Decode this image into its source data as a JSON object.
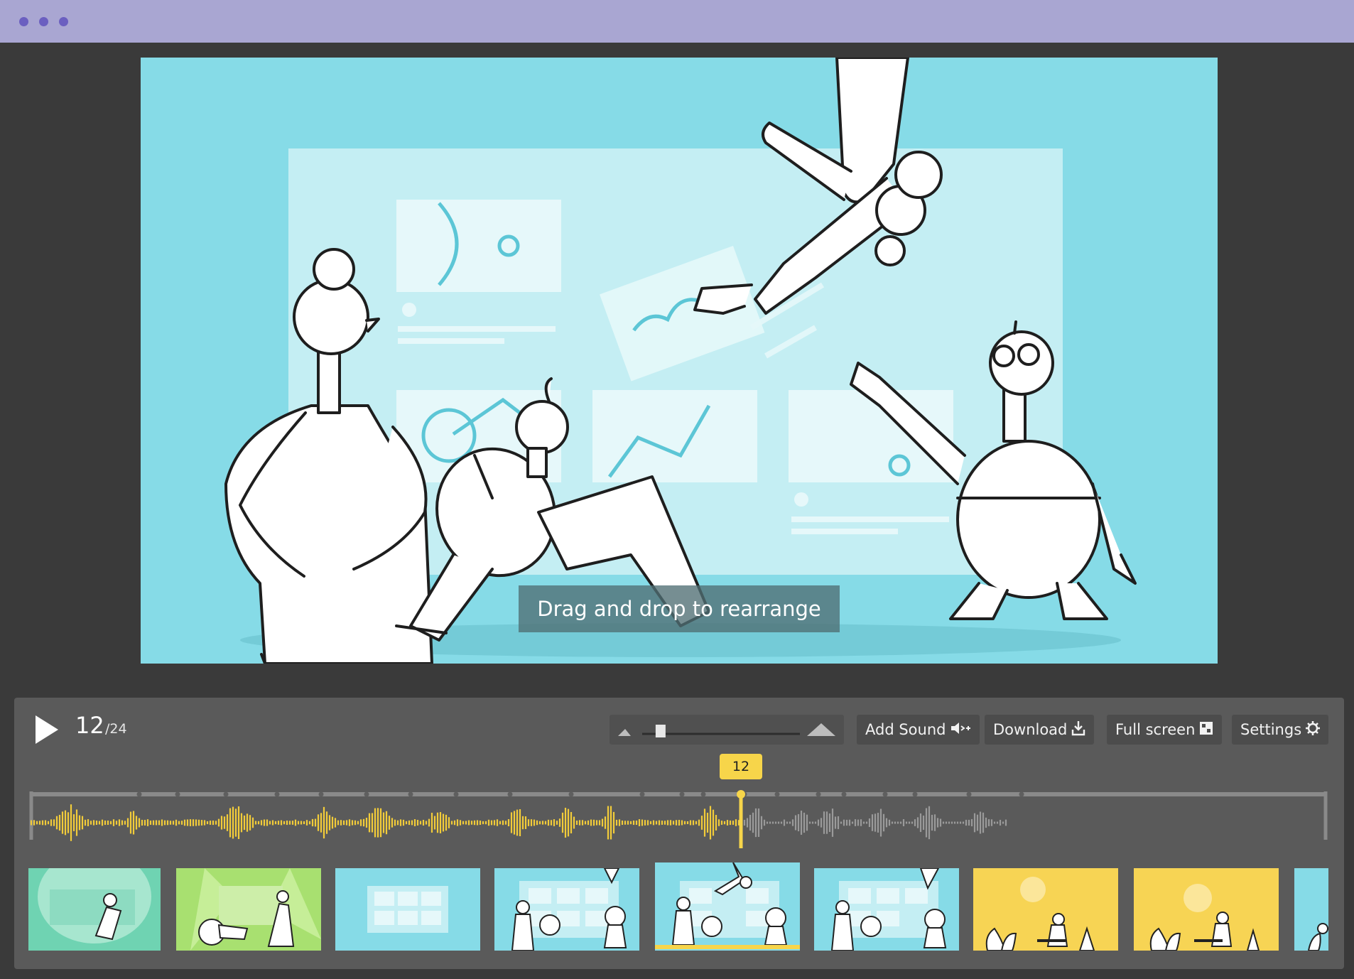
{
  "caption": "Drag and drop to rearrange",
  "player": {
    "current_frame": "12",
    "total_frames": "/24",
    "marker_label": "12",
    "volume": 0.12
  },
  "toolbar": {
    "add_sound_label": "Add Sound",
    "download_label": "Download",
    "fullscreen_label": "Full screen",
    "settings_label": "Settings"
  },
  "colors": {
    "titlebar": "#a9a6d2",
    "window_dots": "#6b5fc0",
    "stage_bg": "#86dbe7",
    "panel_bg": "#5a5a5a",
    "accent_yellow": "#f7d54a",
    "waveform_played": "#f2cc3a",
    "waveform_unplayed": "#9a9a9a"
  },
  "icons": {
    "play": "play-icon",
    "add_sound": "speaker-plus-icon",
    "download": "download-icon",
    "fullscreen": "fullscreen-grid-icon",
    "settings": "gear-icon",
    "volume_low": "mountain-small-icon",
    "volume_high": "mountain-large-icon"
  },
  "thumbnails": [
    {
      "name": "thumb-1",
      "bg": "#6fd3b2"
    },
    {
      "name": "thumb-2",
      "bg": "#a8e070"
    },
    {
      "name": "thumb-3",
      "bg": "#86dbe7"
    },
    {
      "name": "thumb-4",
      "bg": "#86dbe7"
    },
    {
      "name": "thumb-5",
      "bg": "#86dbe7",
      "selected": true
    },
    {
      "name": "thumb-6",
      "bg": "#86dbe7"
    },
    {
      "name": "thumb-7",
      "bg": "#f7d454"
    },
    {
      "name": "thumb-8",
      "bg": "#f7d454"
    },
    {
      "name": "thumb-9",
      "bg": "#86dbe7"
    }
  ]
}
